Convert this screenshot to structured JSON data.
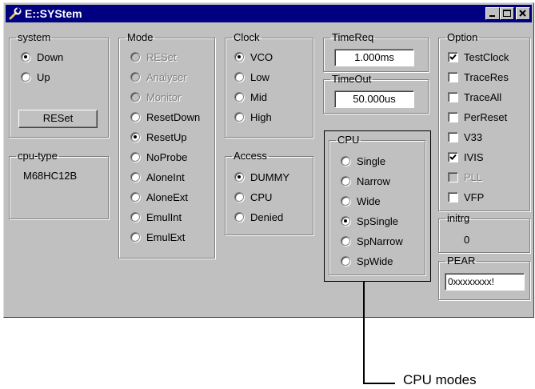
{
  "window": {
    "title": "E::SYStem",
    "icon": "wrench-icon",
    "controls": [
      "minimize-icon",
      "maximize-icon",
      "close-icon"
    ]
  },
  "system": {
    "legend": "system",
    "options": [
      {
        "label": "Down",
        "checked": true
      },
      {
        "label": "Up",
        "checked": false
      }
    ],
    "button": "RESet"
  },
  "cpu_type": {
    "legend": "cpu-type",
    "value": "M68HC12B"
  },
  "mode": {
    "legend": "Mode",
    "options": [
      {
        "label": "RESet",
        "checked": false,
        "disabled": true
      },
      {
        "label": "Analyser",
        "checked": false,
        "disabled": true
      },
      {
        "label": "Monitor",
        "checked": false,
        "disabled": true
      },
      {
        "label": "ResetDown",
        "checked": false,
        "disabled": false
      },
      {
        "label": "ResetUp",
        "checked": true,
        "disabled": false
      },
      {
        "label": "NoProbe",
        "checked": false,
        "disabled": false
      },
      {
        "label": "AloneInt",
        "checked": false,
        "disabled": false
      },
      {
        "label": "AloneExt",
        "checked": false,
        "disabled": false
      },
      {
        "label": "EmulInt",
        "checked": false,
        "disabled": false
      },
      {
        "label": "EmulExt",
        "checked": false,
        "disabled": false
      }
    ]
  },
  "clock": {
    "legend": "Clock",
    "options": [
      {
        "label": "VCO",
        "checked": true
      },
      {
        "label": "Low",
        "checked": false
      },
      {
        "label": "Mid",
        "checked": false
      },
      {
        "label": "High",
        "checked": false
      }
    ]
  },
  "access": {
    "legend": "Access",
    "options": [
      {
        "label": "DUMMY",
        "checked": true
      },
      {
        "label": "CPU",
        "checked": false
      },
      {
        "label": "Denied",
        "checked": false
      }
    ]
  },
  "timereq": {
    "legend": "TimeReq",
    "value": "1.000ms"
  },
  "timeout": {
    "legend": "TimeOut",
    "value": "50.000us"
  },
  "cpu": {
    "legend": "CPU",
    "options": [
      {
        "label": "Single",
        "checked": false
      },
      {
        "label": "Narrow",
        "checked": false
      },
      {
        "label": "Wide",
        "checked": false
      },
      {
        "label": "SpSingle",
        "checked": true
      },
      {
        "label": "SpNarrow",
        "checked": false
      },
      {
        "label": "SpWide",
        "checked": false
      }
    ]
  },
  "option": {
    "legend": "Option",
    "items": [
      {
        "label": "TestClock",
        "checked": true,
        "disabled": false
      },
      {
        "label": "TraceRes",
        "checked": false,
        "disabled": false
      },
      {
        "label": "TraceAll",
        "checked": false,
        "disabled": false
      },
      {
        "label": "PerReset",
        "checked": false,
        "disabled": false
      },
      {
        "label": "V33",
        "checked": false,
        "disabled": false
      },
      {
        "label": "IVIS",
        "checked": true,
        "disabled": false
      },
      {
        "label": "PLL",
        "checked": false,
        "disabled": true
      },
      {
        "label": "VFP",
        "checked": false,
        "disabled": false
      }
    ]
  },
  "initrg": {
    "legend": "initrg",
    "value": "0"
  },
  "pear": {
    "legend": "PEAR",
    "value": "0xxxxxxxx!"
  },
  "annotation": {
    "label": "CPU modes"
  }
}
